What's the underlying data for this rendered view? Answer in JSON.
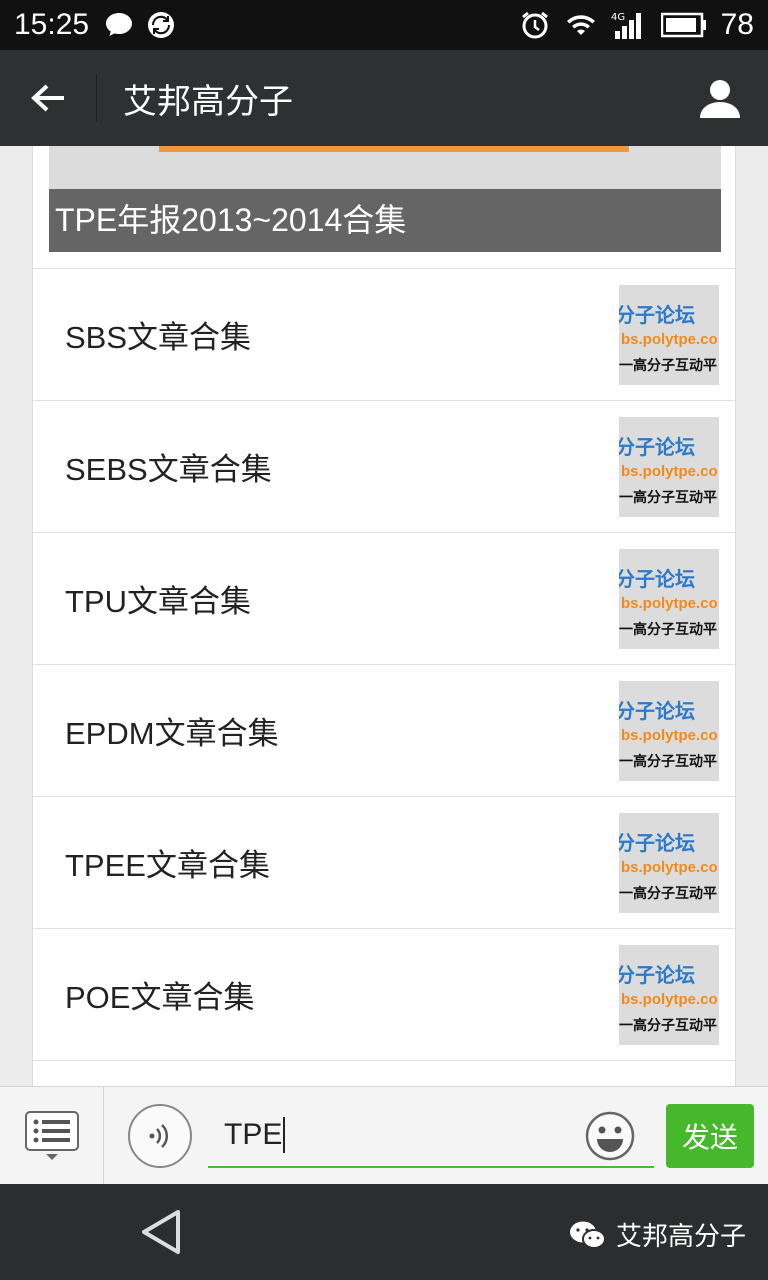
{
  "status_bar": {
    "time": "15:25",
    "network": "4G",
    "battery": "78"
  },
  "header": {
    "title": "艾邦高分子"
  },
  "cover": {
    "caption": "TPE年报2013~2014合集"
  },
  "articles": [
    {
      "label": "SBS文章合集"
    },
    {
      "label": "SEBS文章合集"
    },
    {
      "label": "TPU文章合集"
    },
    {
      "label": "EPDM文章合集"
    },
    {
      "label": "TPEE文章合集"
    },
    {
      "label": "POE文章合集"
    }
  ],
  "thumbnail": {
    "line1": "分子论坛",
    "line2": "bs.polytpe.co",
    "line3": "一高分子互动平"
  },
  "input_bar": {
    "text": "TPE",
    "send_label": "发送"
  },
  "watermark": {
    "text": "艾邦高分子"
  },
  "colors": {
    "titlebar": "#2e3132",
    "send_button": "#45b82c",
    "input_underline": "#4cb93c"
  }
}
